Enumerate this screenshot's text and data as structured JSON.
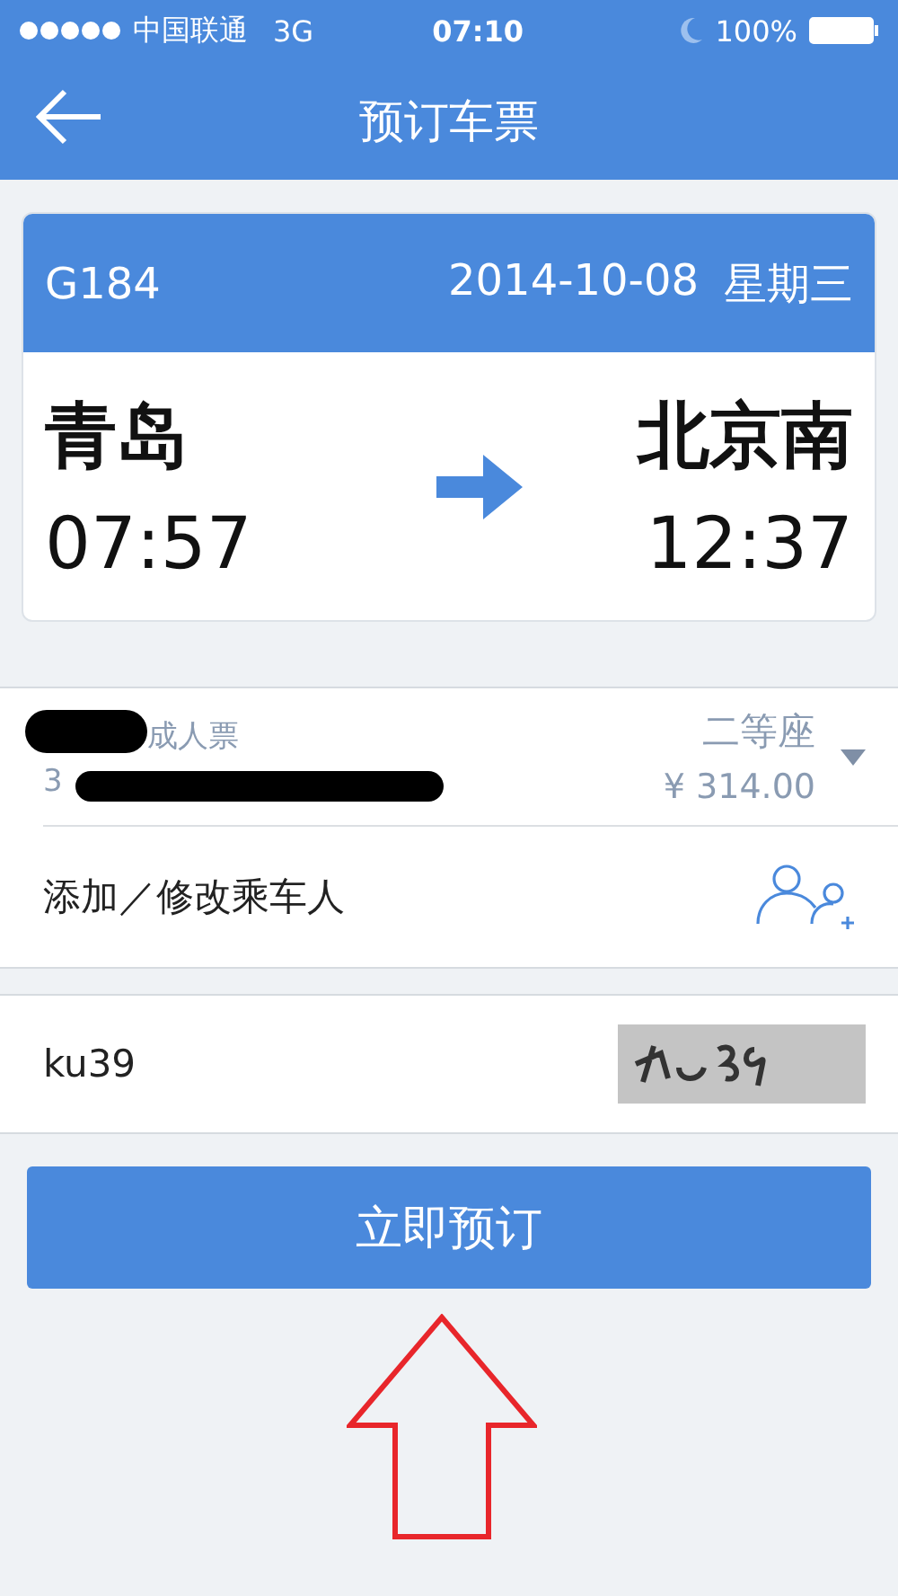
{
  "status_bar": {
    "carrier": "中国联通",
    "network": "3G",
    "time": "07:10",
    "battery": "100%"
  },
  "nav": {
    "title": "预订车票"
  },
  "train": {
    "number": "G184",
    "date": "2014-10-08",
    "weekday": "星期三",
    "from": "青岛",
    "depart": "07:57",
    "to": "北京南",
    "arrive": "12:37"
  },
  "passenger": {
    "ticket_type": "成人票",
    "id_number": "3",
    "seat": "二等座",
    "price": "¥ 314.00"
  },
  "add_passenger": {
    "label": "添加／修改乘车人"
  },
  "captcha": {
    "value": "ku39"
  },
  "submit": {
    "label": "立即预订"
  }
}
